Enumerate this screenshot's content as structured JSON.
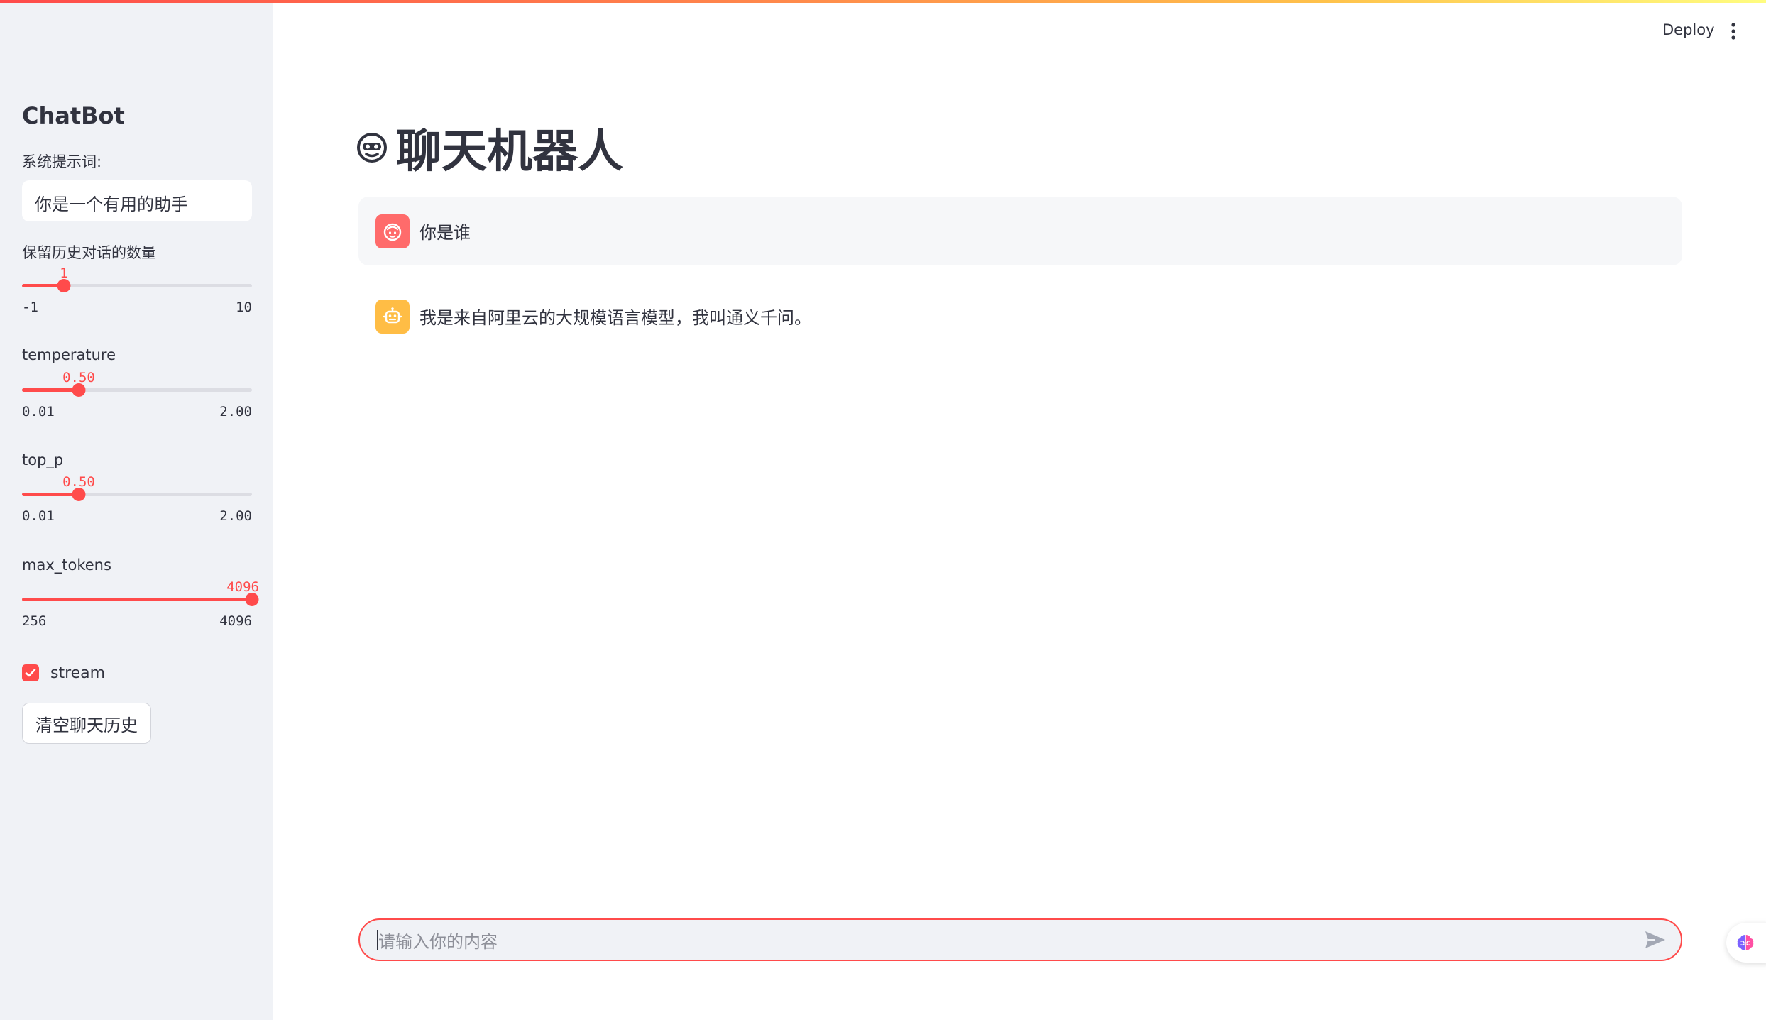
{
  "colors": {
    "accent": "#ff4b4b",
    "sidebar_bg": "#f0f2f6",
    "user_avatar": "#ff6b6b",
    "bot_avatar": "#ffbd45",
    "text": "#31333f"
  },
  "header": {
    "deploy_label": "Deploy",
    "menu_icon": "vertical-ellipsis-icon"
  },
  "sidebar": {
    "title": "ChatBot",
    "system_prompt": {
      "label": "系统提示词:",
      "value": "你是一个有用的助手"
    },
    "history_slider": {
      "label": "保留历史对话的数量",
      "value": "1",
      "min": "-1",
      "max": "10",
      "fraction": 0.1818
    },
    "temperature_slider": {
      "label": "temperature",
      "value": "0.50",
      "min": "0.01",
      "max": "2.00",
      "fraction": 0.2462
    },
    "top_p_slider": {
      "label": "top_p",
      "value": "0.50",
      "min": "0.01",
      "max": "2.00",
      "fraction": 0.2462
    },
    "max_tokens_slider": {
      "label": "max_tokens",
      "value": "4096",
      "min": "256",
      "max": "4096",
      "fraction": 1.0
    },
    "stream": {
      "label": "stream",
      "checked": true
    },
    "clear_button": "清空聊天历史"
  },
  "main": {
    "title": "聊天机器人",
    "title_icon": "robot-face-icon",
    "messages": [
      {
        "role": "user",
        "avatar_icon": "user-face-icon",
        "text": "你是谁"
      },
      {
        "role": "assistant",
        "avatar_icon": "robot-icon",
        "text": "我是来自阿里云的大规模语言模型，我叫通义千问。"
      }
    ],
    "chat_input": {
      "placeholder": "请输入你的内容",
      "send_icon": "send-icon"
    }
  },
  "floating_icon": "brain-icon"
}
